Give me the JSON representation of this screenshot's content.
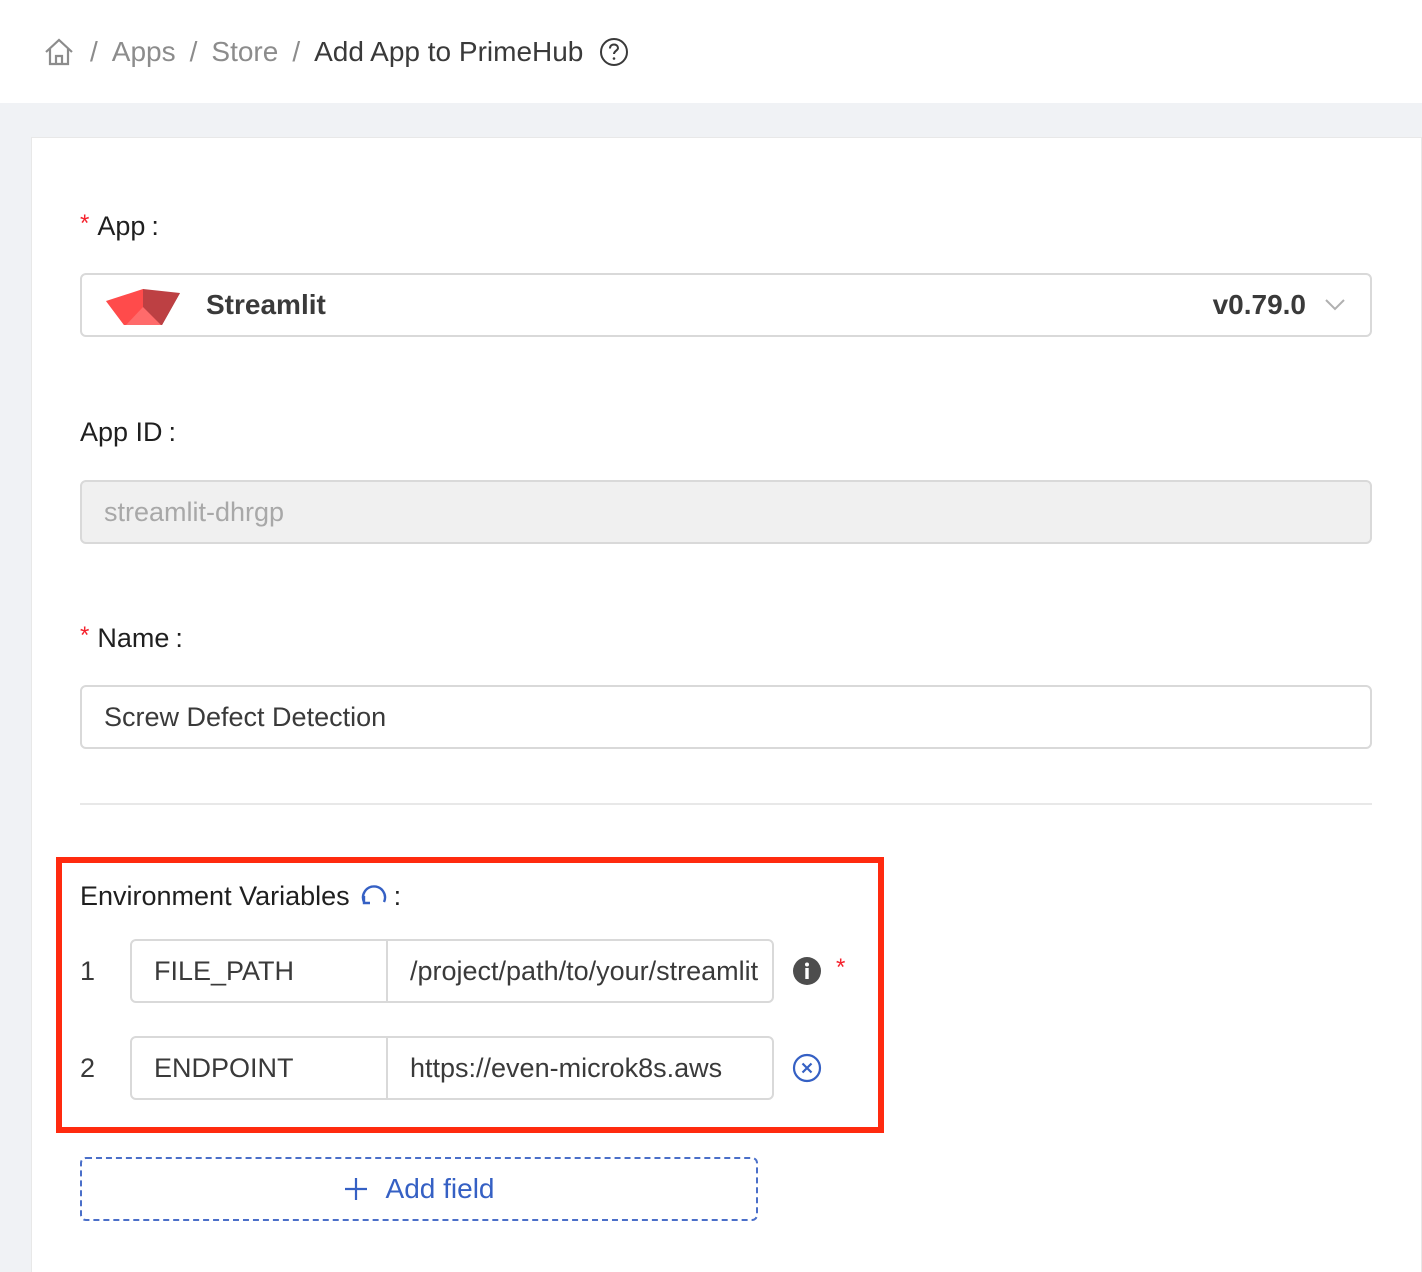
{
  "breadcrumb": {
    "home_icon": "home-icon",
    "sep1": "/",
    "apps": "Apps",
    "sep2": "/",
    "store": "Store",
    "sep3": "/",
    "current": "Add App to PrimeHub",
    "help_icon": "question-circle-icon"
  },
  "form": {
    "app": {
      "required_mark": "*",
      "label": "App",
      "colon": ":",
      "selected_name": "Streamlit",
      "selected_version": "v0.79.0",
      "logo_icon": "streamlit-logo",
      "dropdown_icon": "chevron-down-icon"
    },
    "app_id": {
      "label": "App ID",
      "colon": ":",
      "value": "streamlit-dhrgp"
    },
    "name": {
      "required_mark": "*",
      "label": "Name",
      "colon": ":",
      "value": "Screw Defect Detection"
    },
    "env": {
      "label": "Environment Variables",
      "colon": ":",
      "sync_icon": "sync-icon",
      "rows": [
        {
          "index": "1",
          "key": "FILE_PATH",
          "value": "/project/path/to/your/streamlit",
          "action_icon": "info-circle-icon",
          "required_mark": "*"
        },
        {
          "index": "2",
          "key": "ENDPOINT",
          "value": "https://even-microk8s.aws",
          "action_icon": "close-circle-icon"
        }
      ],
      "add_label": "Add field",
      "add_icon": "plus-icon"
    }
  },
  "colors": {
    "accent": "#3560c4",
    "required": "#f5222d",
    "highlight_box": "#ff2a0f",
    "streamlit_red": "#ff4b4b"
  }
}
